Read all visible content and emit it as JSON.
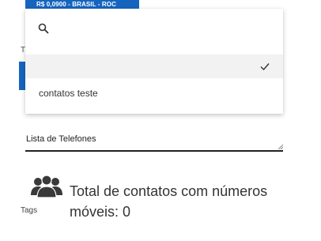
{
  "header": {
    "price_badge": "R$ 0,0900 - BRASIL - ROC",
    "partial_label": "Ti"
  },
  "dropdown": {
    "search_placeholder": "",
    "selected_option_label": "",
    "options": [
      "contatos teste"
    ]
  },
  "phone_list": {
    "label": "Lista de Telefones"
  },
  "tags": {
    "label": "Tags"
  },
  "summary": {
    "total_text": "Total de contatos com números móveis: 0"
  },
  "colors": {
    "accent": "#1565c0",
    "selected_row": "#f2f2f2",
    "underline": "#222222"
  },
  "icons": [
    "search-icon",
    "check-icon",
    "resize-handle-icon",
    "contacts-group-icon"
  ]
}
